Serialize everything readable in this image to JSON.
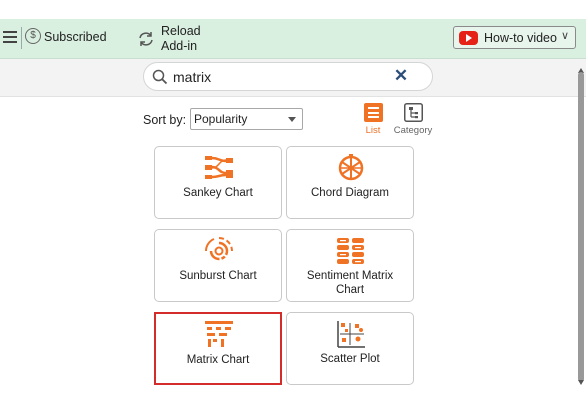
{
  "toolbar": {
    "subscribed_label": "Subscribed",
    "reload_line1": "Reload",
    "reload_line2": "Add-in",
    "howto_label": "How-to video",
    "accent": "#d9efe0"
  },
  "search": {
    "value": "matrix",
    "clear_symbol": "✕"
  },
  "sort": {
    "label": "Sort by:",
    "selected": "Popularity"
  },
  "view_toggle": {
    "list_label": "List",
    "category_label": "Category",
    "active": "List",
    "accent": "#f07325"
  },
  "charts": [
    {
      "label": "Sankey Chart",
      "icon": "sankey-icon",
      "selected": false
    },
    {
      "label": "Chord Diagram",
      "icon": "chord-icon",
      "selected": false
    },
    {
      "label": "Sunburst Chart",
      "icon": "sunburst-icon",
      "selected": false
    },
    {
      "label": "Sentiment Matrix Chart",
      "icon": "sentiment-matrix-icon",
      "selected": false
    },
    {
      "label": "Matrix Chart",
      "icon": "matrix-icon",
      "selected": true
    },
    {
      "label": "Scatter Plot",
      "icon": "scatter-icon",
      "selected": false
    }
  ],
  "icon_color": "#f07325",
  "selection_color": "#d42b2b"
}
